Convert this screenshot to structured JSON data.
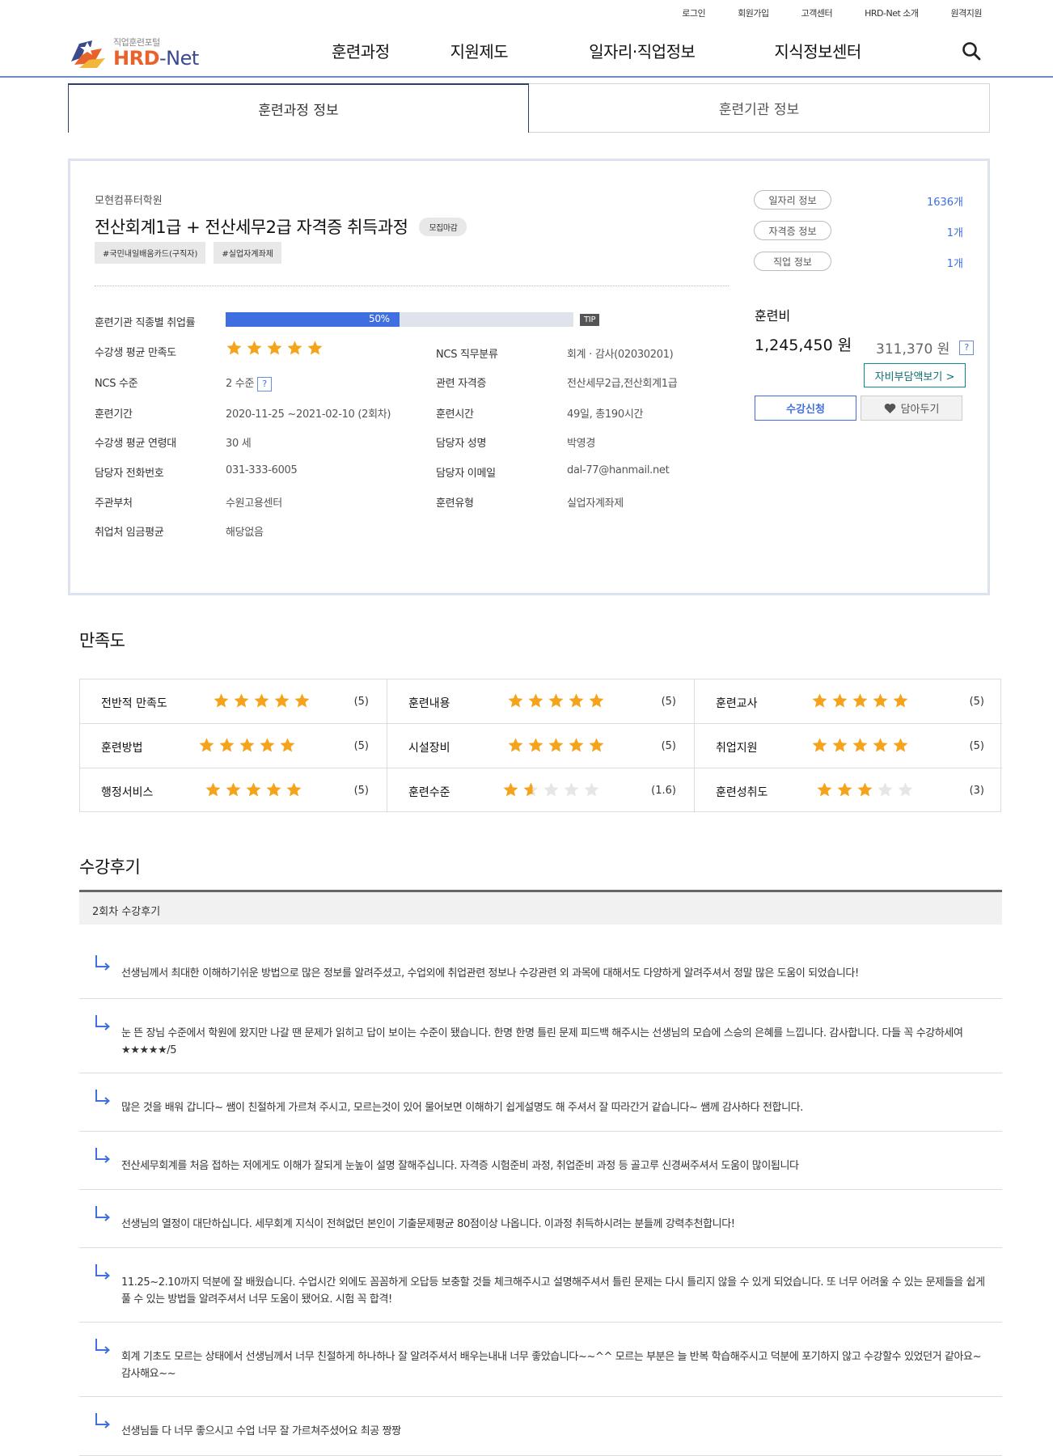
{
  "util_links": [
    "로그인",
    "회원가입",
    "고객센터",
    "HRD-Net 소개",
    "원격지원"
  ],
  "logo": {
    "small": "직업훈련포털",
    "big_a": "HRD",
    "big_b": "-Net"
  },
  "gnb": [
    "훈련과정",
    "지원제도",
    "일자리·직업정보",
    "지식정보센터"
  ],
  "tabs": [
    "훈련과정 정보",
    "훈련기관 정보"
  ],
  "course": {
    "institution": "모현컴퓨터학원",
    "title": "전산회계1급 + 전산세무2급 자격증 취득과정",
    "status_badge": "모집마감",
    "tags": [
      "#국민내일배움카드(구직자)",
      "#실업자계좌제"
    ],
    "employment_rate_label": "훈련기관 직종별 취업률",
    "employment_rate_text": "50%",
    "employment_rate_value": 0.5,
    "tip": "TIP",
    "satisfaction_label": "수강생 평균 만족도",
    "satisfaction_stars": 5,
    "ncs_class_label": "NCS 직무분류",
    "ncs_class_value": "회계 · 감사(02030201)",
    "ncs_level_label": "NCS 수준",
    "ncs_level_value": "2 수준",
    "cert_label": "관련 자격증",
    "cert_value": "전산세무2급,전산회계1급",
    "period_label": "훈련기간",
    "period_value": "2020-11-25 ~2021-02-10 (2회차)",
    "hours_label": "훈련시간",
    "hours_value": "49일, 총190시간",
    "age_label": "수강생 평균 연령대",
    "age_value": "30 세",
    "manager_label": "담당자 성명",
    "manager_value": "박영경",
    "phone_label": "담당자 전화번호",
    "phone_value": "031-333-6005",
    "email_label": "담당자 이메일",
    "email_value": "dal-77@hanmail.net",
    "dept_label": "주관부처",
    "dept_value": "수원고용센터",
    "type_label": "훈련유형",
    "type_value": "실업자계좌제",
    "wage_label": "취업처 임금평균",
    "wage_value": "해당없음"
  },
  "side": {
    "job_pill": "일자리 정보",
    "job_count": "1636개",
    "cert_pill": "자격증 정보",
    "cert_count": "1개",
    "occ_pill": "직업 정보",
    "occ_count": "1개",
    "fee_label": "훈련비",
    "fee_main": "1,245,450 원",
    "fee_self": "311,370 원",
    "self_btn": "자비부담액보기 >",
    "apply_btn": "수강신청",
    "wish_btn": "담아두기"
  },
  "satisfaction": {
    "title": "만족도",
    "items": [
      {
        "name": "전반적 만족도",
        "stars": 5,
        "score": "(5)"
      },
      {
        "name": "훈련내용",
        "stars": 5,
        "score": "(5)"
      },
      {
        "name": "훈련교사",
        "stars": 5,
        "score": "(5)"
      },
      {
        "name": "훈련방법",
        "stars": 5,
        "score": "(5)"
      },
      {
        "name": "시설장비",
        "stars": 5,
        "score": "(5)"
      },
      {
        "name": "취업지원",
        "stars": 5,
        "score": "(5)"
      },
      {
        "name": "행정서비스",
        "stars": 5,
        "score": "(5)"
      },
      {
        "name": "훈련수준",
        "stars": 1.6,
        "score": "(1.6)"
      },
      {
        "name": "훈련성취도",
        "stars": 3,
        "score": "(3)"
      }
    ]
  },
  "reviews": {
    "title": "수강후기",
    "round_label": "2회차 수강후기",
    "items": [
      "선생님께서 최대한 이해하기쉬운 방법으로 많은 정보를 알려주셨고, 수업외에 취업관련 정보나 수강관련 외 과목에 대해서도 다양하게 알려주셔서 정말 많은 도움이 되었습니다!",
      "눈 뜬 장님 수준에서 학원에 왔지만 나갈 땐 문제가 읽히고 답이 보이는 수준이 됐습니다. 한명 한명 틀린 문제 피드백 해주시는 선생님의 모습에 스승의 은혜를 느낍니다. 감사합니다. 다들 꼭 수강하세여 ★★★★★/5",
      "많은 것을 배워 갑니다~ 쌤이 친절하게 가르쳐 주시고, 모르는것이 있어 물어보면 이해하기 쉽게설명도 해 주셔서 잘 따라간거 같습니다~ 쌤께 감사하다 전합니다.",
      "전산세무회계를 처음 접하는 저에게도 이해가 잘되게 눈높이 설명 잘해주십니다. 자격증 시험준비 과정, 취업준비 과정 등 골고루 신경써주셔서 도움이 많이됩니다",
      "선생님의 열정이 대단하십니다. 세무회계 지식이 전혀없던 본인이 기출문제평균 80점이상 나옵니다. 이과정 취득하시려는 분들께 강력추천합니다!",
      "11.25~2.10까지 덕분에 잘 배웠습니다. 수업시간 외에도 꼼꼼하게 오답등 보충할 것들 체크해주시고 설명해주셔서 틀린 문제는 다시 틀리지 않을 수 있게 되었습니다. 또 너무 어려울 수 있는 문제들을 쉽게 풀 수 있는 방법들 알려주셔서 너무 도움이 됐어요. 시험 꼭 합격!",
      "회계 기초도 모르는 상태에서 선생님께서 너무 친절하게 하나하나 잘 알려주셔서 배우는내내 너무 좋았습니다~~^^ 모르는 부분은 늘 반복 학습해주시고 덕분에 포기하지 않고 수강할수 있었던거 같아요~ 감사해요~~",
      "선생님들 다 너무 좋으시고 수업 너무 잘 가르쳐주셨어요 최공 짱짱"
    ]
  }
}
